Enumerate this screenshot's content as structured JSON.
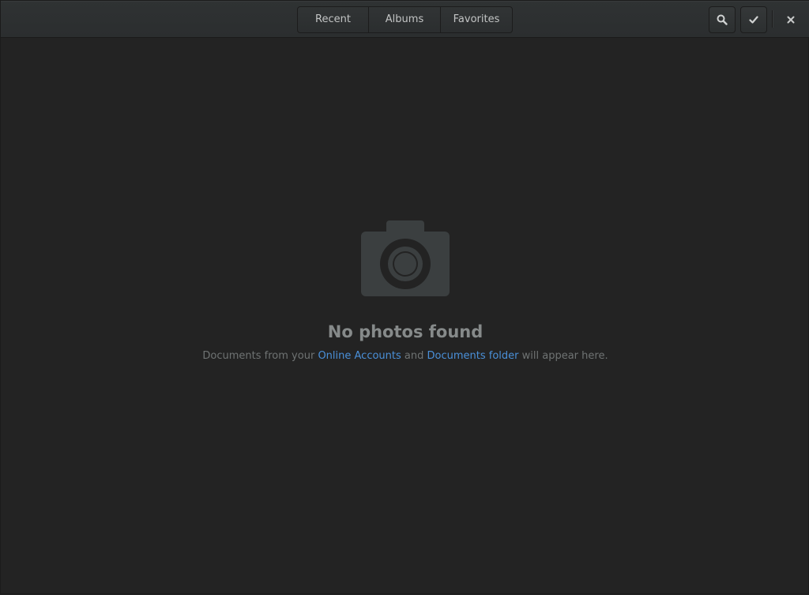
{
  "header": {
    "tabs": [
      {
        "label": "Recent",
        "active": false
      },
      {
        "label": "Albums",
        "active": false
      },
      {
        "label": "Favorites",
        "active": false
      }
    ],
    "buttons": {
      "search_icon": "search-icon",
      "select_icon": "checkmark-icon",
      "close_icon": "close-icon"
    }
  },
  "empty_state": {
    "icon": "camera-icon",
    "title": "No photos found",
    "description": {
      "prefix": "Documents from your ",
      "link1": "Online Accounts",
      "middle": " and ",
      "link2": "Documents folder",
      "suffix": " will appear here."
    }
  },
  "colors": {
    "background": "#232323",
    "headerbar": "#2d3031",
    "link": "#4a90d9",
    "title": "#868a8a",
    "icon": "#3b3f40"
  }
}
